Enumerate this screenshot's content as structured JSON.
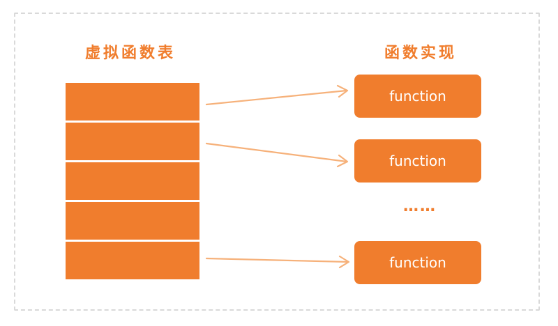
{
  "headings": {
    "vtable": "虚拟函数表",
    "impl": "函数实现"
  },
  "table": {
    "rows": 5
  },
  "functions": {
    "labels": [
      "function",
      "function",
      "function"
    ],
    "ellipsis": "……"
  },
  "colors": {
    "accent": "#f07d2d",
    "arrow": "#f6b17a",
    "border": "#d9d9d9"
  }
}
